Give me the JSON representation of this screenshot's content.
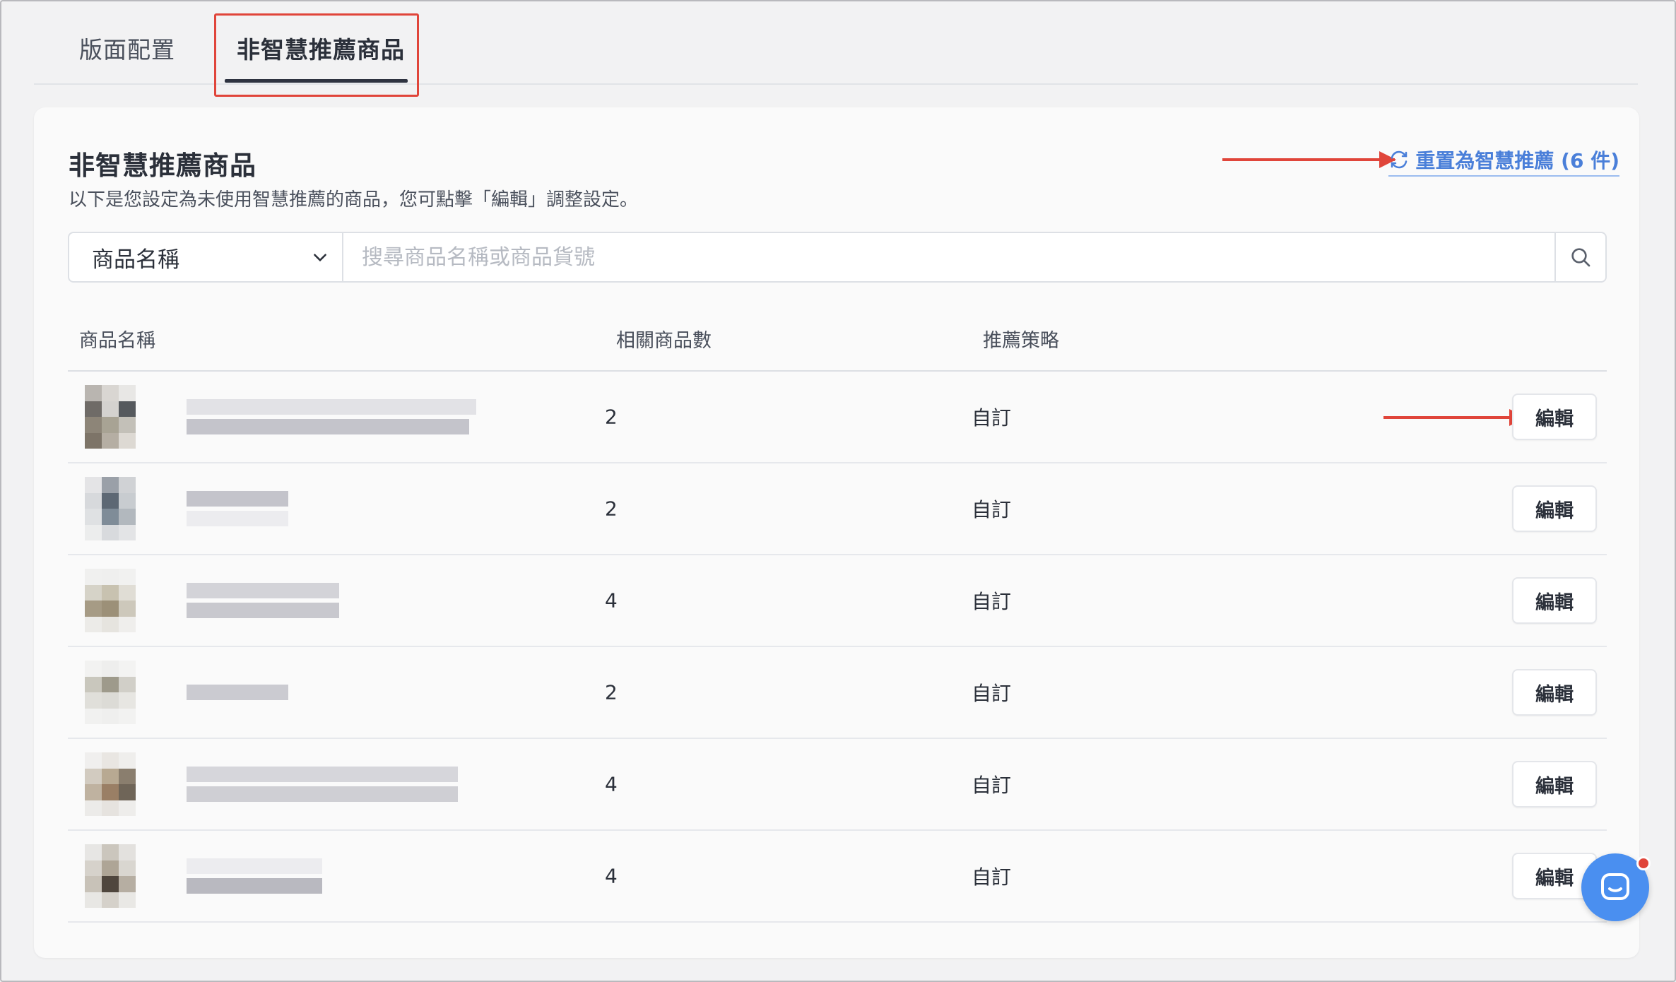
{
  "tabs": [
    {
      "label": "版面配置"
    },
    {
      "label": "非智慧推薦商品"
    }
  ],
  "card": {
    "title": "非智慧推薦商品",
    "description": "以下是您設定為未使用智慧推薦的商品，您可點擊「編輯」調整設定。",
    "reset_link": "重置為智慧推薦 (6 件)"
  },
  "search": {
    "select_value": "商品名稱",
    "placeholder": "搜尋商品名稱或商品貨號"
  },
  "table": {
    "headers": {
      "name": "商品名稱",
      "count": "相關商品數",
      "strategy": "推薦策略"
    },
    "rows": [
      {
        "count": "2",
        "strategy": "自訂",
        "action": "編輯"
      },
      {
        "count": "2",
        "strategy": "自訂",
        "action": "編輯"
      },
      {
        "count": "4",
        "strategy": "自訂",
        "action": "編輯"
      },
      {
        "count": "2",
        "strategy": "自訂",
        "action": "編輯"
      },
      {
        "count": "4",
        "strategy": "自訂",
        "action": "編輯"
      },
      {
        "count": "4",
        "strategy": "自訂",
        "action": "編輯"
      }
    ]
  },
  "colors": {
    "annotation": "#e0453a",
    "link": "#4a7fd9",
    "chat": "#4a8ff0"
  },
  "icons": [
    "refresh-icon",
    "chevron-down-icon",
    "search-icon",
    "chat-icon"
  ]
}
